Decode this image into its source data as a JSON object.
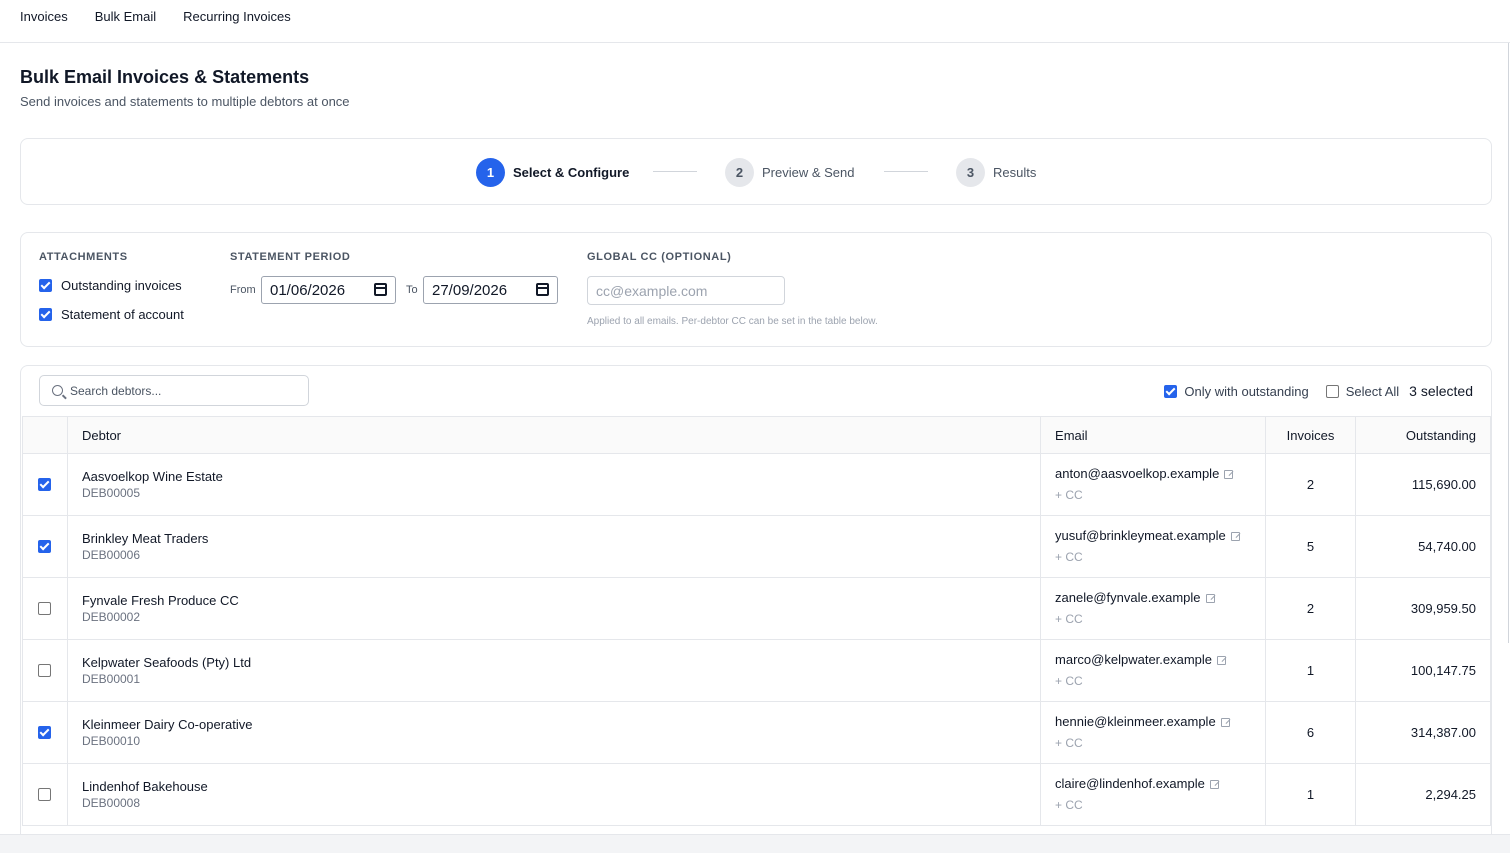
{
  "nav": {
    "invoices": "Invoices",
    "bulk_email": "Bulk Email",
    "recurring": "Recurring Invoices"
  },
  "header": {
    "title": "Bulk Email Invoices & Statements",
    "subtitle": "Send invoices and statements to multiple debtors at once"
  },
  "stepper": {
    "steps": [
      {
        "num": "1",
        "label": "Select & Configure",
        "active": true
      },
      {
        "num": "2",
        "label": "Preview & Send",
        "active": false
      },
      {
        "num": "3",
        "label": "Results",
        "active": false
      }
    ]
  },
  "config": {
    "attachments_label": "ATTACHMENTS",
    "outstanding_invoices": "Outstanding invoices",
    "outstanding_invoices_checked": true,
    "statement_of_account": "Statement of account",
    "statement_of_account_checked": true,
    "period_label": "STATEMENT PERIOD",
    "from_label": "From",
    "from_value": "01/06/2026",
    "to_label": "To",
    "to_value": "27/09/2026",
    "cc_label": "GLOBAL CC (OPTIONAL)",
    "cc_placeholder": "cc@example.com",
    "cc_help": "Applied to all emails. Per-debtor CC can be set in the table below."
  },
  "toolbar": {
    "search_placeholder": "Search debtors...",
    "only_outstanding": "Only with outstanding",
    "only_outstanding_checked": true,
    "select_all": "Select All",
    "select_all_checked": false,
    "selected_count": "3 selected"
  },
  "table": {
    "headers": {
      "debtor": "Debtor",
      "email": "Email",
      "invoices": "Invoices",
      "outstanding": "Outstanding"
    },
    "add_cc_label": "+ CC",
    "rows": [
      {
        "checked": true,
        "name": "Aasvoelkop Wine Estate",
        "code": "DEB00005",
        "email": "anton@aasvoelkop.example",
        "invoices": "2",
        "outstanding": "115,690.00"
      },
      {
        "checked": true,
        "name": "Brinkley Meat Traders",
        "code": "DEB00006",
        "email": "yusuf@brinkleymeat.example",
        "invoices": "5",
        "outstanding": "54,740.00"
      },
      {
        "checked": false,
        "name": "Fynvale Fresh Produce CC",
        "code": "DEB00002",
        "email": "zanele@fynvale.example",
        "invoices": "2",
        "outstanding": "309,959.50"
      },
      {
        "checked": false,
        "name": "Kelpwater Seafoods (Pty) Ltd",
        "code": "DEB00001",
        "email": "marco@kelpwater.example",
        "invoices": "1",
        "outstanding": "100,147.75"
      },
      {
        "checked": true,
        "name": "Kleinmeer Dairy Co-operative",
        "code": "DEB00010",
        "email": "hennie@kleinmeer.example",
        "invoices": "6",
        "outstanding": "314,387.00"
      },
      {
        "checked": false,
        "name": "Lindenhof Bakehouse",
        "code": "DEB00008",
        "email": "claire@lindenhof.example",
        "invoices": "1",
        "outstanding": "2,294.25"
      }
    ]
  },
  "colors": {
    "accent": "#2563eb",
    "border": "#e5e7eb",
    "muted": "#6b7280"
  }
}
